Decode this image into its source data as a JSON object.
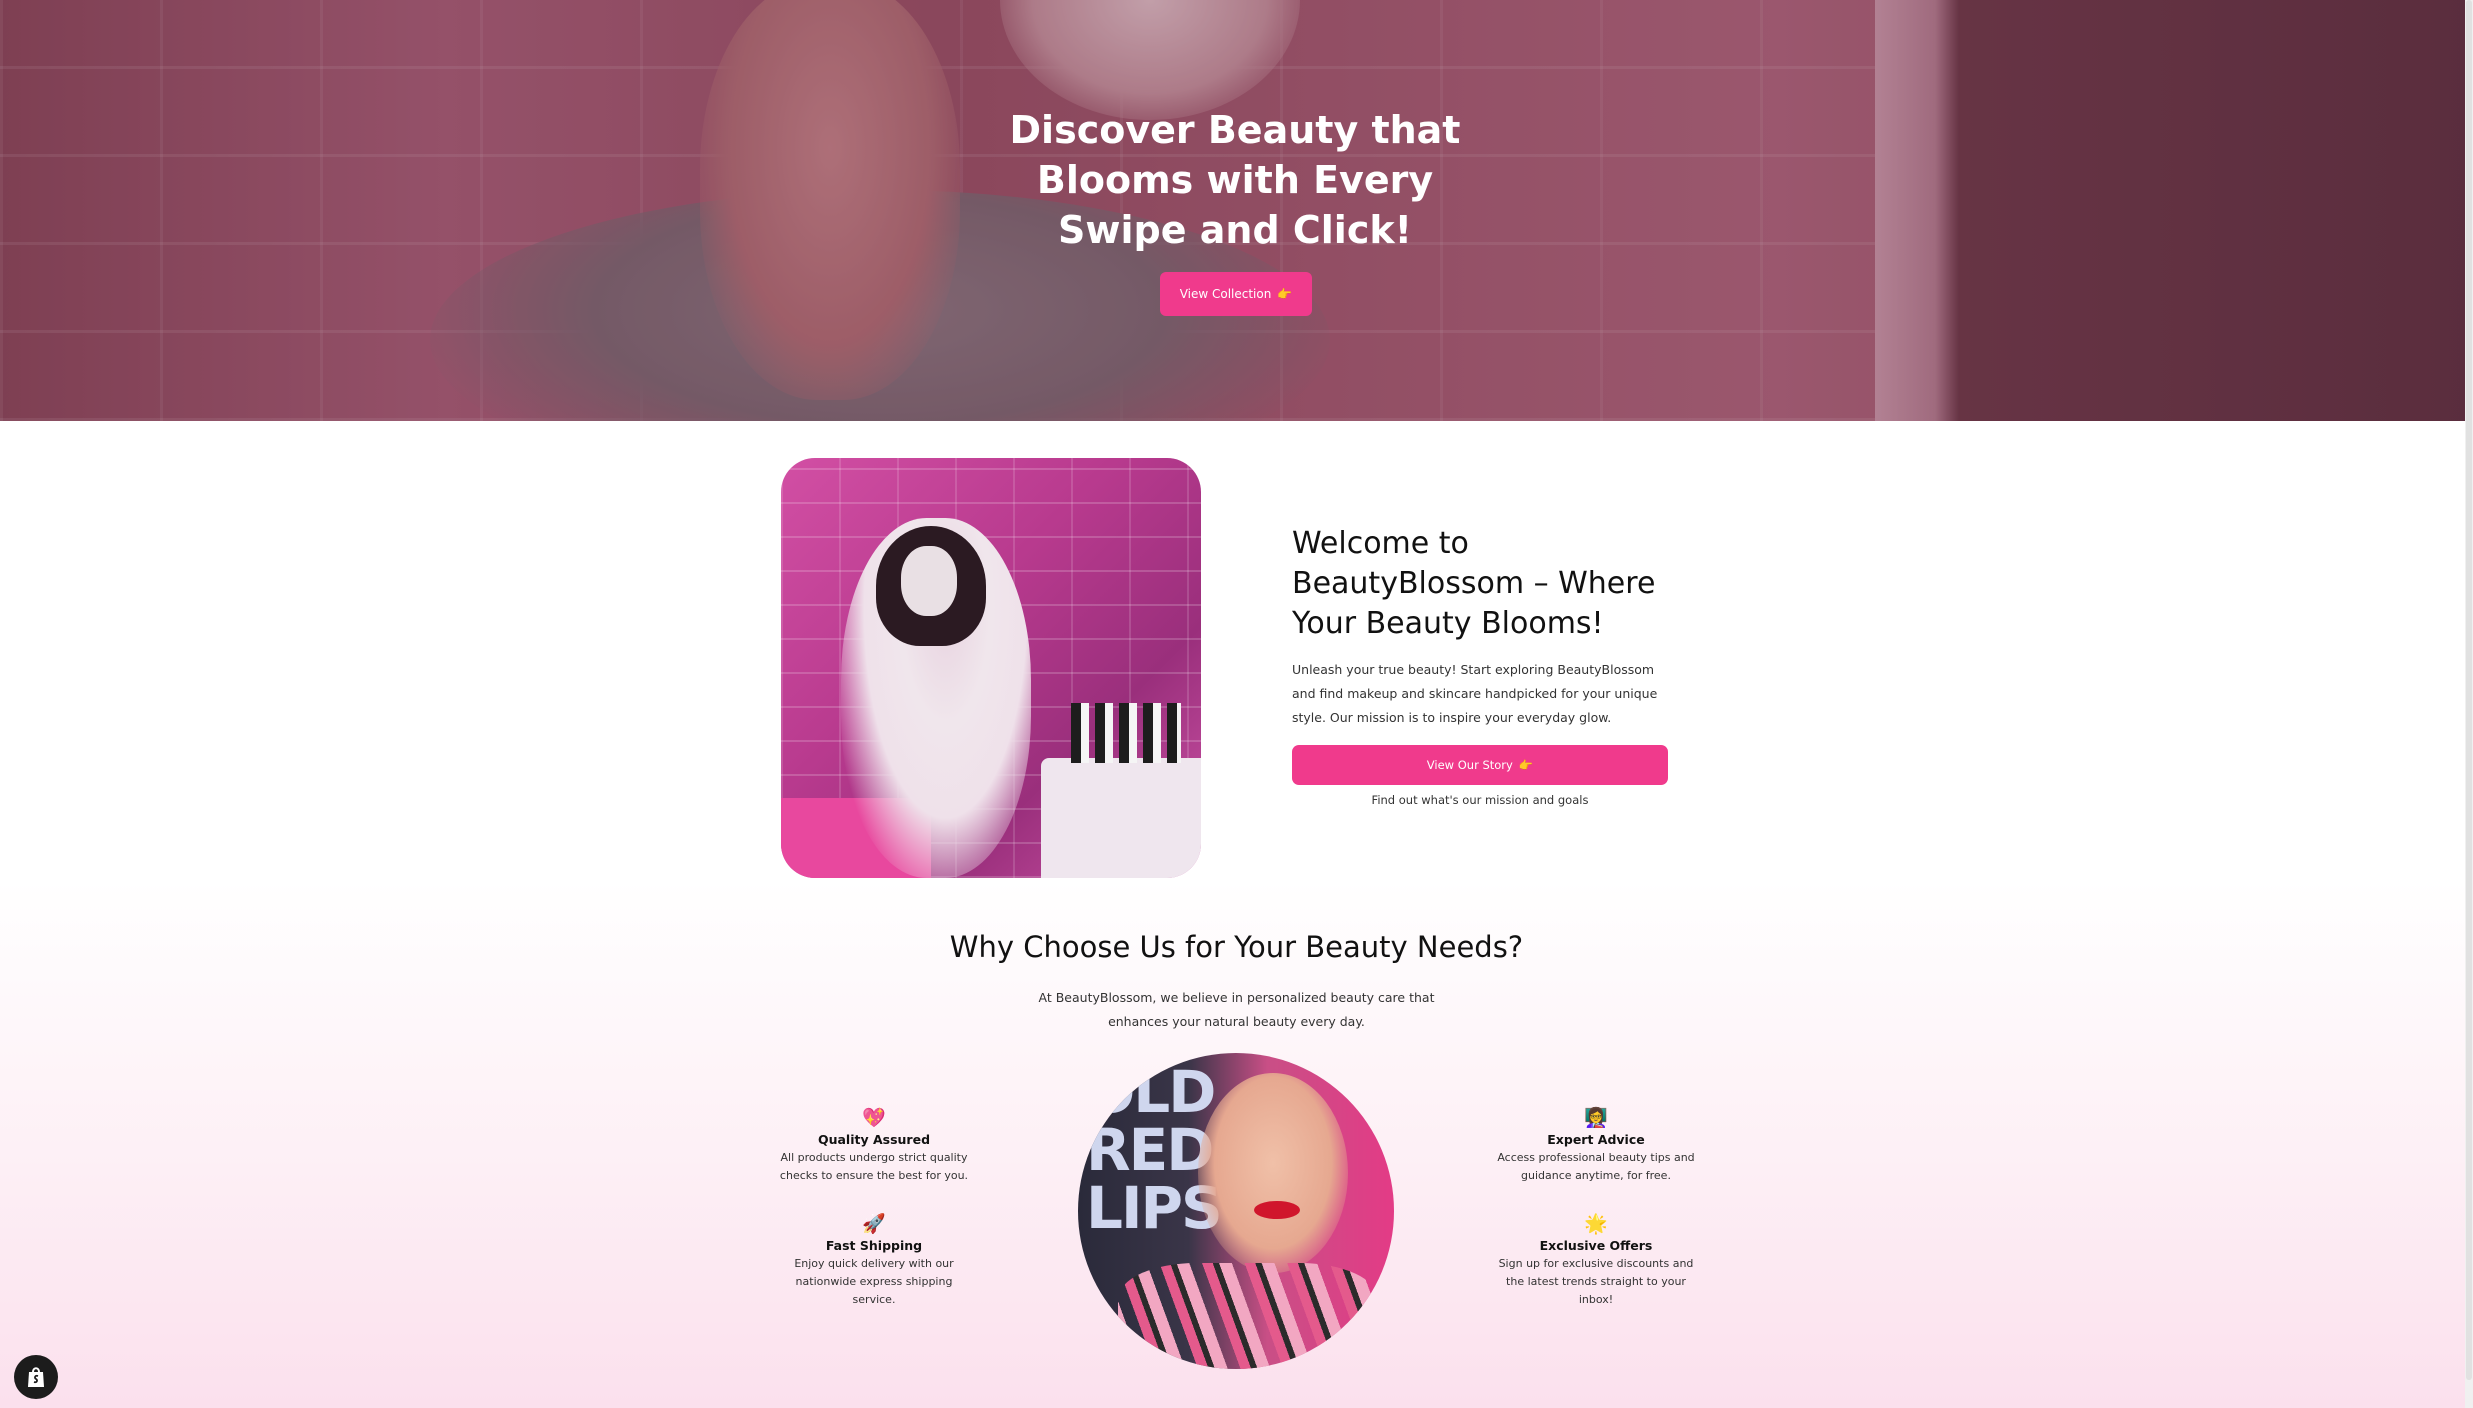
{
  "hero": {
    "title": "Discover Beauty that Blooms with Every Swipe and Click!",
    "button_label": "View Collection",
    "button_icon": "pointing-hand-icon"
  },
  "welcome": {
    "title": "Welcome to BeautyBlossom – Where Your Beauty Blooms!",
    "text": "Unleash your true beauty! Start exploring BeautyBlossom and find makeup and skincare handpicked for your unique style. Our mission is to inspire your everyday glow.",
    "button_label": "View Our Story",
    "button_icon": "pointing-hand-icon",
    "subtext": "Find out what's our mission and goals"
  },
  "why": {
    "title": "Why Choose Us for Your Beauty Needs?",
    "subtitle": "At BeautyBlossom, we believe in personalized beauty care that enhances your natural beauty every day.",
    "features": [
      {
        "icon": "heart-icon",
        "glyph": "💖",
        "title": "Quality Assured",
        "text": "All products undergo strict quality checks to ensure the best for you."
      },
      {
        "icon": "rocket-icon",
        "glyph": "🚀",
        "title": "Fast Shipping",
        "text": "Enjoy quick delivery with our nationwide express shipping service."
      },
      {
        "icon": "advisor-icon",
        "glyph": "👩‍🏫",
        "title": "Expert Advice",
        "text": "Access professional beauty tips and guidance anytime, for free."
      },
      {
        "icon": "sparkle-icon",
        "glyph": "🌟",
        "title": "Exclusive Offers",
        "text": "Sign up for exclusive discounts and the latest trends straight to your inbox!"
      }
    ],
    "image_sign_text": "OLD RED LIPS"
  },
  "colors": {
    "accent": "#f03a8c",
    "hero_overlay": "#a8627a",
    "gradient_bottom": "#fbe0ed"
  }
}
